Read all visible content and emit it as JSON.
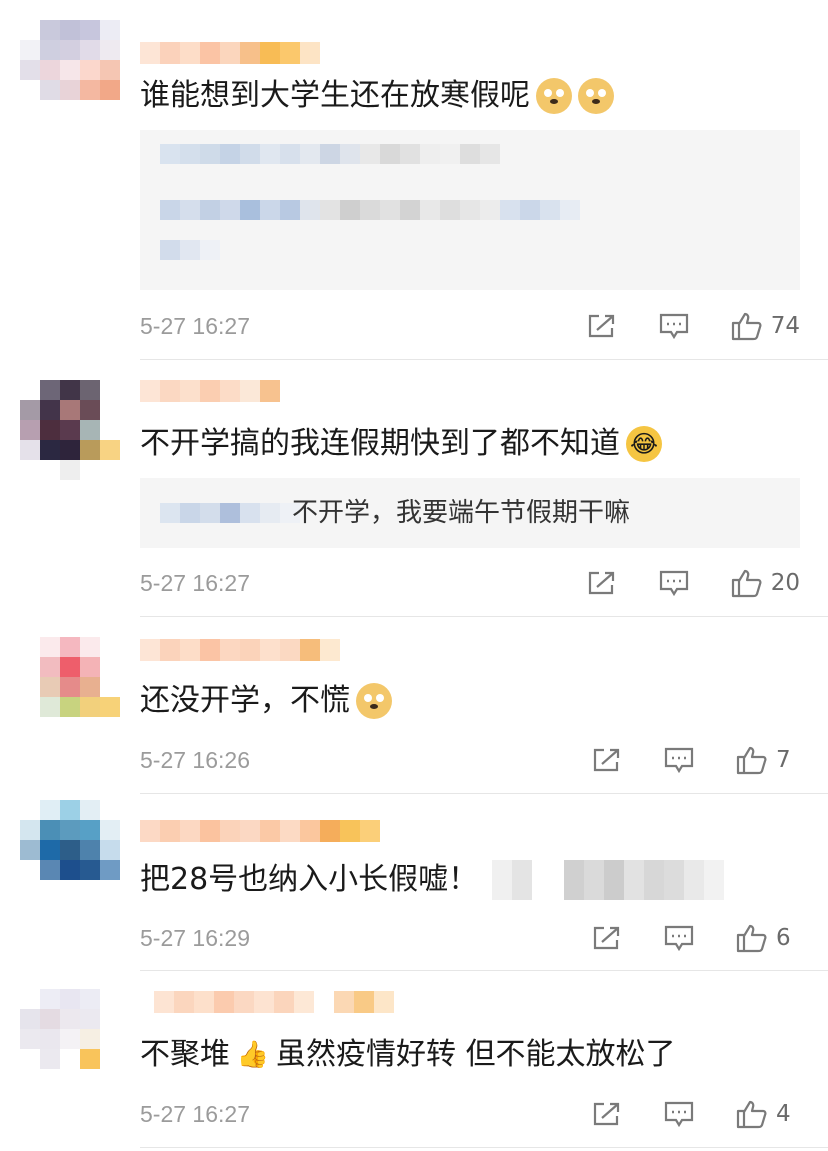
{
  "comments": [
    {
      "text": "谁能想到大学生还在放寒假呢",
      "emojis": [
        "doge",
        "doge"
      ],
      "time": "5-27 16:27",
      "likes": "74",
      "avatar_colors": [
        "#ffffff",
        "#c9c9dc",
        "#c1c1d8",
        "#c7c6dd",
        "#ececf4",
        "#f2f2f6",
        "#cfcfe0",
        "#d3cfe0",
        "#e1dbe8",
        "#eeeaf0",
        "#e3dfe9",
        "#ecd6dc",
        "#f6e6e9",
        "#fbd7cc",
        "#f5c6b3",
        "#ffffff",
        "#e0dce6",
        "#e8d3d8",
        "#f4b8a1",
        "#f2a888",
        "#ffffff",
        "#ffffff",
        "#ffffff",
        "#ffffff",
        "#ffffff"
      ],
      "name_colors": [
        "#fde5d6",
        "#fbd2bb",
        "#fdddc8",
        "#fbc4a5",
        "#fbd6bd",
        "#f7c08a",
        "#f8bc55",
        "#fbc86c",
        "#fde4c5"
      ],
      "reply_rows": [
        [
          "#d9e3ef",
          "#d4dfec",
          "#cfdbe9",
          "#c5d3e6",
          "#d1dcea",
          "#e0e7f0",
          "#d7e0ec",
          "#e3e8ef",
          "#cdd6e4",
          "#dfe4ec",
          "#e8e8e8",
          "#d9d9d9",
          "#e1e1e1",
          "#eeeeee",
          "#f0f0f0",
          "#dedede",
          "#e6e6e6"
        ],
        [
          "#c9d6e8",
          "#d5deec",
          "#c2d0e4",
          "#cfd9ea",
          "#a9bfdd",
          "#cbd7e9",
          "#b8c9e2",
          "#dfe4ec",
          "#e3e3e3",
          "#cfcfcf",
          "#dadada",
          "#e1e1e1",
          "#d3d3d3",
          "#e8e8e8",
          "#dedede",
          "#e6e6e6",
          "#ececec",
          "#d8e1ee",
          "#cbd7e9",
          "#d9e2ee",
          "#e7ecf3"
        ],
        [
          "#d2dceb",
          "#e1e7f1",
          "#eef1f6"
        ]
      ]
    },
    {
      "text": "不开学搞的我连假期快到了都不知道",
      "emojis": [
        "laugh"
      ],
      "emoji_glyphs": {
        "laugh": "😂"
      },
      "reply_text": "不开学，我要端午节假期干嘛",
      "time": "5-27 16:27",
      "likes": "20",
      "avatar_colors": [
        "#ffffff",
        "#6d6677",
        "#413548",
        "#6c6471",
        "#ffffff",
        "#a49aa6",
        "#43344a",
        "#a87878",
        "#6a4c57",
        "#ffffff",
        "#b79fb0",
        "#4d2e3e",
        "#5a3a4e",
        "#a7b5b5",
        "#ffffff",
        "#e5e1ea",
        "#2b2841",
        "#2e243b",
        "#b99b5b",
        "#f8d383",
        "#ffffff",
        "#ffffff",
        "#eeeeee",
        "#ffffff",
        "#ffffff"
      ],
      "name_colors": [
        "#fde5d6",
        "#fbd8c2",
        "#fce0cc",
        "#fbceb1",
        "#fcdcc7",
        "#fbe8d8",
        "#f7c28f",
        "#ffffff",
        "#ffffff"
      ],
      "reply_row": [
        "#dce5f0",
        "#c9d6e8",
        "#d3ddeb",
        "#aebfdc",
        "#d8e1ee",
        "#e6ebf2",
        "#eef1f6"
      ]
    },
    {
      "text": "还没开学，不慌",
      "emojis": [
        "doge"
      ],
      "time": "5-27 16:26",
      "likes": "7",
      "avatar_colors": [
        "#ffffff",
        "#fbeaec",
        "#f5b8c0",
        "#fbeaec",
        "#ffffff",
        "#ffffff",
        "#f2bcc0",
        "#ee5e6b",
        "#f4b3b6",
        "#ffffff",
        "#ffffff",
        "#e8cbb5",
        "#e58b8a",
        "#e8b090",
        "#ffffff",
        "#ffffff",
        "#dfe9d8",
        "#c8d37f",
        "#f2d07c",
        "#f7d278",
        "#ffffff",
        "#ffffff",
        "#ffffff",
        "#ffffff",
        "#ffffff"
      ],
      "name_colors": [
        "#fde5d6",
        "#fbd3bb",
        "#fdddc8",
        "#fbc4a5",
        "#fcd7c1",
        "#fbd3ba",
        "#fde0cc",
        "#fbd9c2",
        "#f6bd7b",
        "#fde9d0"
      ]
    },
    {
      "text": "把28号也纳入小长假嘘！",
      "emojis": [],
      "time": "5-27 16:29",
      "likes": "6",
      "avatar_colors": [
        "#ffffff",
        "#e0eef5",
        "#9cd0e6",
        "#e3eef4",
        "#ffffff",
        "#d4e6ef",
        "#4b8fb6",
        "#5c9bbe",
        "#57a0c6",
        "#e3eef4",
        "#9dbbd2",
        "#1e6aa8",
        "#2d5e89",
        "#4e82ac",
        "#c6dcec",
        "#ffffff",
        "#5a87b3",
        "#1d4f8d",
        "#275a91",
        "#6f9bc4",
        "#ffffff",
        "#ffffff",
        "#ffffff",
        "#ffffff",
        "#ffffff"
      ],
      "name_colors": [
        "#fcd9c5",
        "#fbceb1",
        "#fcd8c2",
        "#fbc39f",
        "#fbd3ba",
        "#fbd8c3",
        "#fbc9a6",
        "#fcdac4",
        "#fbc79e",
        "#f5ad5b",
        "#f8c35a",
        "#fbcf79"
      ],
      "trail_blur": [
        [
          "#f0f0f0",
          "#e4e4e4"
        ],
        [
          "#d0d0d0",
          "#dadada",
          "#cccccc",
          "#e2e2e2",
          "#d7d7d7",
          "#dcdcdc",
          "#e9e9e9",
          "#f2f2f2"
        ]
      ]
    },
    {
      "text_before": "不聚堆",
      "emojis": [
        "thumb"
      ],
      "emoji_glyphs": {
        "thumb": "👍"
      },
      "text_after": "虽然疫情好转 但不能太放松了",
      "time": "5-27 16:27",
      "likes": "4",
      "avatar_colors": [
        "#ffffff",
        "#ededf5",
        "#e8e6f1",
        "#ececf4",
        "#ffffff",
        "#e6e4ec",
        "#e4dbe2",
        "#ece8ee",
        "#ebe9f0",
        "#ffffff",
        "#ebe9ef",
        "#eae7ee",
        "#f4f2f5",
        "#f6efe3",
        "#ffffff",
        "#ffffff",
        "#ebe9ef",
        "#ffffff",
        "#f9c45b",
        "#ffffff",
        "#ffffff",
        "#ffffff",
        "#ffffff",
        "#ffffff",
        "#ffffff"
      ],
      "name_colors": [
        "#ffffff",
        "#fde4d3",
        "#fbd6be",
        "#fde0cb",
        "#fbcbae",
        "#fbd8c2",
        "#fde3d1",
        "#fbd5bc",
        "#fde8d6",
        "#ffffff",
        "#fbd8b4",
        "#f9ca86",
        "#fde6c8"
      ]
    }
  ],
  "icons": {
    "share": "share-icon",
    "comment": "comment-icon",
    "like": "like-icon"
  }
}
